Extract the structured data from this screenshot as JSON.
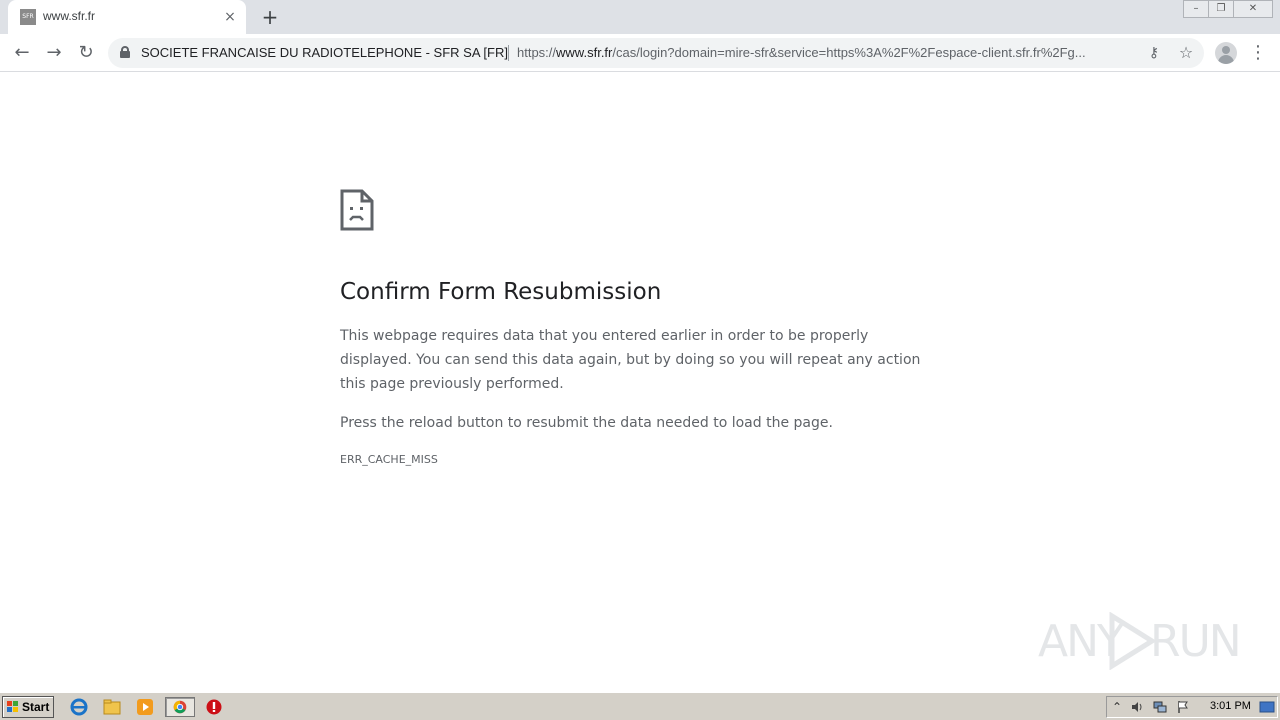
{
  "browser": {
    "tab": {
      "favicon_text": "SFR",
      "title": "www.sfr.fr",
      "close": "×"
    },
    "new_tab": "+",
    "window_controls": {
      "minimize": "–",
      "restore": "❐",
      "close": "✕"
    },
    "nav": {
      "back": "←",
      "forward": "→",
      "reload": "↻"
    },
    "omnibox": {
      "org": "SOCIETE FRANCAISE DU RADIOTELEPHONE - SFR SA [FR]",
      "url_scheme": "https://",
      "url_host": "www.sfr.fr",
      "url_path": "/cas/login?domain=mire-sfr&service=https%3A%2F%2Fespace-client.sfr.fr%2Fg..."
    },
    "icons": {
      "key": "⚷",
      "star": "☆",
      "menu": "⋮"
    }
  },
  "error_page": {
    "title": "Confirm Form Resubmission",
    "body": "This webpage requires data that you entered earlier in order to be properly displayed. You can send this data again, but by doing so you will repeat any action this page previously performed.",
    "hint": "Press the reload button to resubmit the data needed to load the page.",
    "code": "ERR_CACHE_MISS"
  },
  "watermark": {
    "left": "ANY",
    "right": "RUN"
  },
  "taskbar": {
    "start_label": "Start",
    "clock": "3:01 PM",
    "tray_arrow": "⌃"
  },
  "colors": {
    "tabstrip": "#dee1e6",
    "omnibox": "#f1f3f4",
    "title_text": "#202124",
    "body_text": "#5f6368",
    "taskbar": "#d4d0c8"
  }
}
